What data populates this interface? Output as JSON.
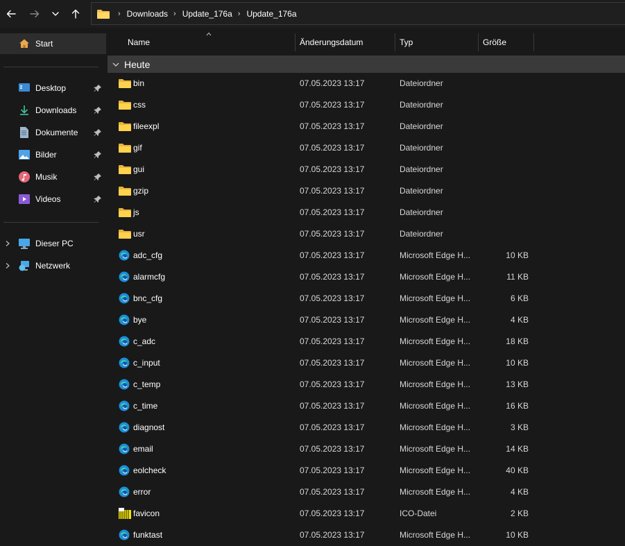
{
  "address": {
    "crumbs": [
      "Downloads",
      "Update_176a",
      "Update_176a"
    ]
  },
  "sidebar": {
    "start": "Start",
    "quick": [
      {
        "label": "Desktop",
        "icon": "desktop-icon"
      },
      {
        "label": "Downloads",
        "icon": "download-icon"
      },
      {
        "label": "Dokumente",
        "icon": "document-icon"
      },
      {
        "label": "Bilder",
        "icon": "pictures-icon"
      },
      {
        "label": "Musik",
        "icon": "music-icon"
      },
      {
        "label": "Videos",
        "icon": "video-icon"
      }
    ],
    "this_pc": "Dieser PC",
    "network": "Netzwerk"
  },
  "columns": {
    "name": "Name",
    "date": "Änderungsdatum",
    "type": "Typ",
    "size": "Größe"
  },
  "group": "Heute",
  "files": [
    {
      "name": "bin",
      "date": "07.05.2023 13:17",
      "type": "Dateiordner",
      "size": "",
      "kind": "folder"
    },
    {
      "name": "css",
      "date": "07.05.2023 13:17",
      "type": "Dateiordner",
      "size": "",
      "kind": "folder"
    },
    {
      "name": "fileexpl",
      "date": "07.05.2023 13:17",
      "type": "Dateiordner",
      "size": "",
      "kind": "folder"
    },
    {
      "name": "gif",
      "date": "07.05.2023 13:17",
      "type": "Dateiordner",
      "size": "",
      "kind": "folder"
    },
    {
      "name": "gui",
      "date": "07.05.2023 13:17",
      "type": "Dateiordner",
      "size": "",
      "kind": "folder"
    },
    {
      "name": "gzip",
      "date": "07.05.2023 13:17",
      "type": "Dateiordner",
      "size": "",
      "kind": "folder"
    },
    {
      "name": "js",
      "date": "07.05.2023 13:17",
      "type": "Dateiordner",
      "size": "",
      "kind": "folder"
    },
    {
      "name": "usr",
      "date": "07.05.2023 13:17",
      "type": "Dateiordner",
      "size": "",
      "kind": "folder"
    },
    {
      "name": "adc_cfg",
      "date": "07.05.2023 13:17",
      "type": "Microsoft Edge H...",
      "size": "10 KB",
      "kind": "edge"
    },
    {
      "name": "alarmcfg",
      "date": "07.05.2023 13:17",
      "type": "Microsoft Edge H...",
      "size": "11 KB",
      "kind": "edge"
    },
    {
      "name": "bnc_cfg",
      "date": "07.05.2023 13:17",
      "type": "Microsoft Edge H...",
      "size": "6 KB",
      "kind": "edge"
    },
    {
      "name": "bye",
      "date": "07.05.2023 13:17",
      "type": "Microsoft Edge H...",
      "size": "4 KB",
      "kind": "edge"
    },
    {
      "name": "c_adc",
      "date": "07.05.2023 13:17",
      "type": "Microsoft Edge H...",
      "size": "18 KB",
      "kind": "edge"
    },
    {
      "name": "c_input",
      "date": "07.05.2023 13:17",
      "type": "Microsoft Edge H...",
      "size": "10 KB",
      "kind": "edge"
    },
    {
      "name": "c_temp",
      "date": "07.05.2023 13:17",
      "type": "Microsoft Edge H...",
      "size": "13 KB",
      "kind": "edge"
    },
    {
      "name": "c_time",
      "date": "07.05.2023 13:17",
      "type": "Microsoft Edge H...",
      "size": "16 KB",
      "kind": "edge"
    },
    {
      "name": "diagnost",
      "date": "07.05.2023 13:17",
      "type": "Microsoft Edge H...",
      "size": "3 KB",
      "kind": "edge"
    },
    {
      "name": "email",
      "date": "07.05.2023 13:17",
      "type": "Microsoft Edge H...",
      "size": "14 KB",
      "kind": "edge"
    },
    {
      "name": "eolcheck",
      "date": "07.05.2023 13:17",
      "type": "Microsoft Edge H...",
      "size": "40 KB",
      "kind": "edge"
    },
    {
      "name": "error",
      "date": "07.05.2023 13:17",
      "type": "Microsoft Edge H...",
      "size": "4 KB",
      "kind": "edge"
    },
    {
      "name": "favicon",
      "date": "07.05.2023 13:17",
      "type": "ICO-Datei",
      "size": "2 KB",
      "kind": "ico"
    },
    {
      "name": "funktast",
      "date": "07.05.2023 13:17",
      "type": "Microsoft Edge H...",
      "size": "10 KB",
      "kind": "edge"
    }
  ]
}
